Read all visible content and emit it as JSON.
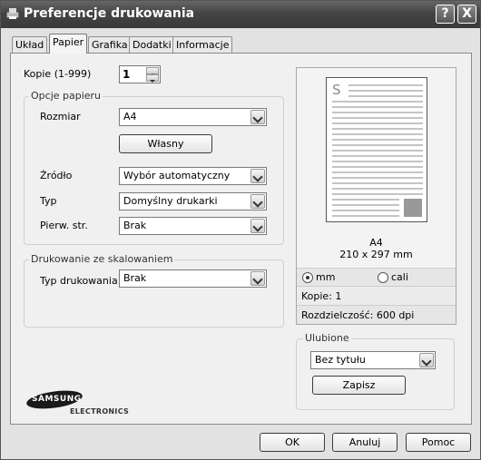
{
  "window": {
    "title": "Preferencje drukowania",
    "help_label": "?",
    "close_label": "X"
  },
  "tabs": [
    {
      "label": "Układ"
    },
    {
      "label": "Papier"
    },
    {
      "label": "Grafika"
    },
    {
      "label": "Dodatki"
    },
    {
      "label": "Informacje"
    }
  ],
  "copies": {
    "label": "Kopie (1-999)",
    "value": "1"
  },
  "paper_options": {
    "title": "Opcje papieru",
    "size": {
      "label": "Rozmiar",
      "value": "A4"
    },
    "custom_button": "Własny",
    "source": {
      "label": "Źródło",
      "value": "Wybór automatyczny"
    },
    "type": {
      "label": "Typ",
      "value": "Domyślny drukarki"
    },
    "first_page": {
      "label": "Pierw. str.",
      "value": "Brak"
    }
  },
  "scaling": {
    "title": "Drukowanie ze skalowaniem",
    "print_type": {
      "label": "Typ drukowania",
      "value": "Brak"
    }
  },
  "preview": {
    "paper_letter": "S",
    "paper_name": "A4",
    "paper_dims": "210 x 297 mm",
    "unit_mm": "mm",
    "unit_inch": "cali",
    "copies_text": "Kopie: 1",
    "resolution_text": "Rozdzielczość: 600 dpi"
  },
  "favorites": {
    "title": "Ulubione",
    "value": "Bez tytułu",
    "save_button": "Zapisz"
  },
  "logo": {
    "brand": "SAMSUNG",
    "sub": "ELECTRONICS"
  },
  "footer": {
    "ok": "OK",
    "cancel": "Anuluj",
    "help": "Pomoc"
  }
}
